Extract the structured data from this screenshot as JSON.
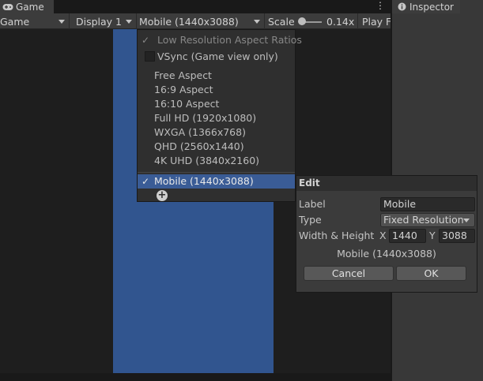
{
  "tabs": {
    "game": "Game",
    "inspector": "Inspector",
    "menu_glyph": "⋮"
  },
  "toolbar": {
    "mode": "Game",
    "display": "Display 1",
    "resolution": "Mobile (1440x3088)",
    "scale_label": "Scale",
    "scale_value": "0.14x",
    "play_focused": "Play Fo"
  },
  "aspect_menu": {
    "low_res": "Low Resolution Aspect Ratios",
    "vsync": "VSync (Game view only)",
    "items": [
      "Free Aspect",
      "16:9 Aspect",
      "16:10 Aspect",
      "Full HD (1920x1080)",
      "WXGA (1366x768)",
      "QHD (2560x1440)",
      "4K UHD (3840x2160)"
    ],
    "selected": "Mobile (1440x3088)",
    "check": "✓",
    "add": "+"
  },
  "edit_popup": {
    "title": "Edit",
    "label_label": "Label",
    "label_value": "Mobile",
    "type_label": "Type",
    "type_value": "Fixed Resolution",
    "wh_label": "Width & Height",
    "x_label": "X",
    "width": "1440",
    "y_label": "Y",
    "height": "3088",
    "preview": "Mobile (1440x3088)",
    "cancel": "Cancel",
    "ok": "OK"
  },
  "colors": {
    "accent_selected": "#3a5c96",
    "game_canvas": "#31558f"
  }
}
